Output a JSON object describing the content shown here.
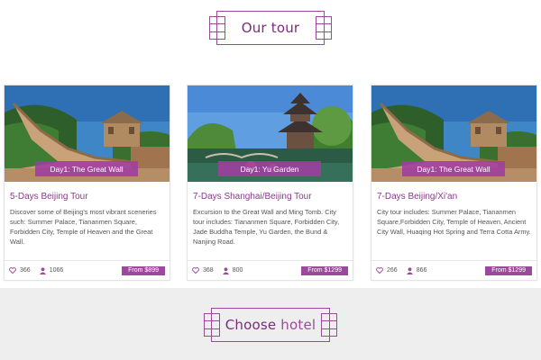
{
  "sections": {
    "tour_title": {
      "main": "Our tour",
      "accent": ""
    },
    "hotel_title": {
      "main": "Choose ",
      "accent": "hotel"
    }
  },
  "tours": [
    {
      "tag": "Day1: The Great Wall",
      "title": "5-Days Beijing Tour",
      "description": "Discover some of Beijing's most vibrant sceneries such: Summer Palace, Tiananmen Square, Forbidden City, Temple of Heaven and the Great Wall.",
      "likes": "366",
      "visitors": "1066",
      "price": "From $899",
      "image": "great-wall"
    },
    {
      "tag": "Day1: Yu Garden",
      "title": "7-Days Shanghai/Beijing Tour",
      "description": "Excursion to the Great Wall and Ming Tomb. City tour includes: Tiananmen Square, Forbidden City, Jade Buddha Temple, Yu Garden, the Bund & Nanjing Road.",
      "likes": "368",
      "visitors": "800",
      "price": "From $1299",
      "image": "yu-garden"
    },
    {
      "tag": "Day1: The Great Wall",
      "title": "7-Days Beijing/Xi'an",
      "description": "City tour includes: Summer Palace, Tiananmen Square,Forbidden City, Temple of Heaven, Ancient City Wall, Huaqing Hot Spring and Terra Cotta Army.",
      "likes": "266",
      "visitors": "866",
      "price": "From $1299",
      "image": "great-wall"
    }
  ],
  "colors": {
    "accent": "#9b4a9b",
    "title": "#8a3a8a",
    "band": "#eeeeee"
  },
  "icons": {
    "likes": "heart-icon",
    "visitors": "person-icon"
  }
}
